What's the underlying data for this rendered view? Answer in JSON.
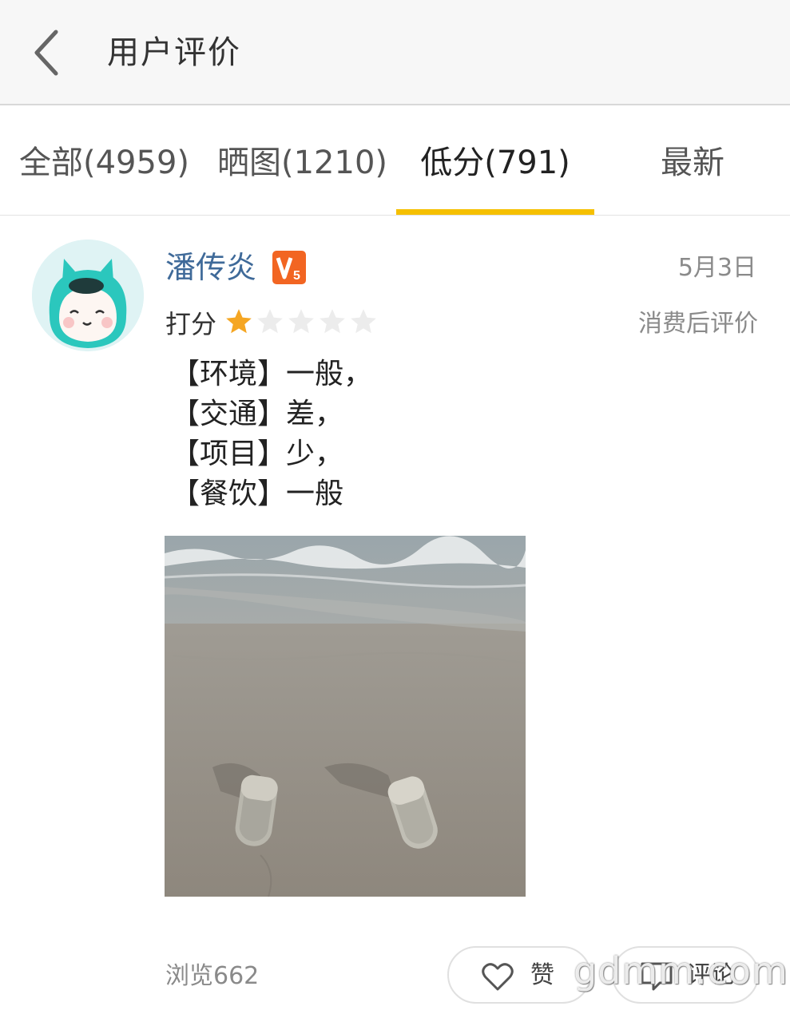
{
  "header": {
    "back_icon": "chevron-left-icon",
    "title": "用户评价"
  },
  "tabs": [
    {
      "label": "全部(4959)",
      "active": false
    },
    {
      "label": "晒图(1210)",
      "active": false
    },
    {
      "label": "低分(791)",
      "active": true
    },
    {
      "label": "最新",
      "active": false
    }
  ],
  "colors": {
    "tab_indicator": "#f5c000",
    "username": "#3f6a99",
    "star_active": "#f5a623",
    "star_inactive": "#ececec",
    "badge": "#f26522"
  },
  "review": {
    "avatar_icon": "cartoon-avatar-icon",
    "username": "潘传炎",
    "badge_icon": "vip-badge-icon",
    "badge_text": "V5",
    "date": "5月3日",
    "score_label": "打分",
    "rating": 1,
    "rating_max": 5,
    "tag": "消费后评价",
    "lines": [
      "【环境】一般，",
      "【交通】差，",
      "【项目】少，",
      "【餐饮】一般"
    ],
    "photo": "beach-slippers-photo"
  },
  "footer": {
    "views": "浏览662",
    "like_label": "赞",
    "like_icon": "heart-icon",
    "comment_label": "评论",
    "comment_icon": "comment-icon"
  },
  "watermark": "gdmm.com"
}
